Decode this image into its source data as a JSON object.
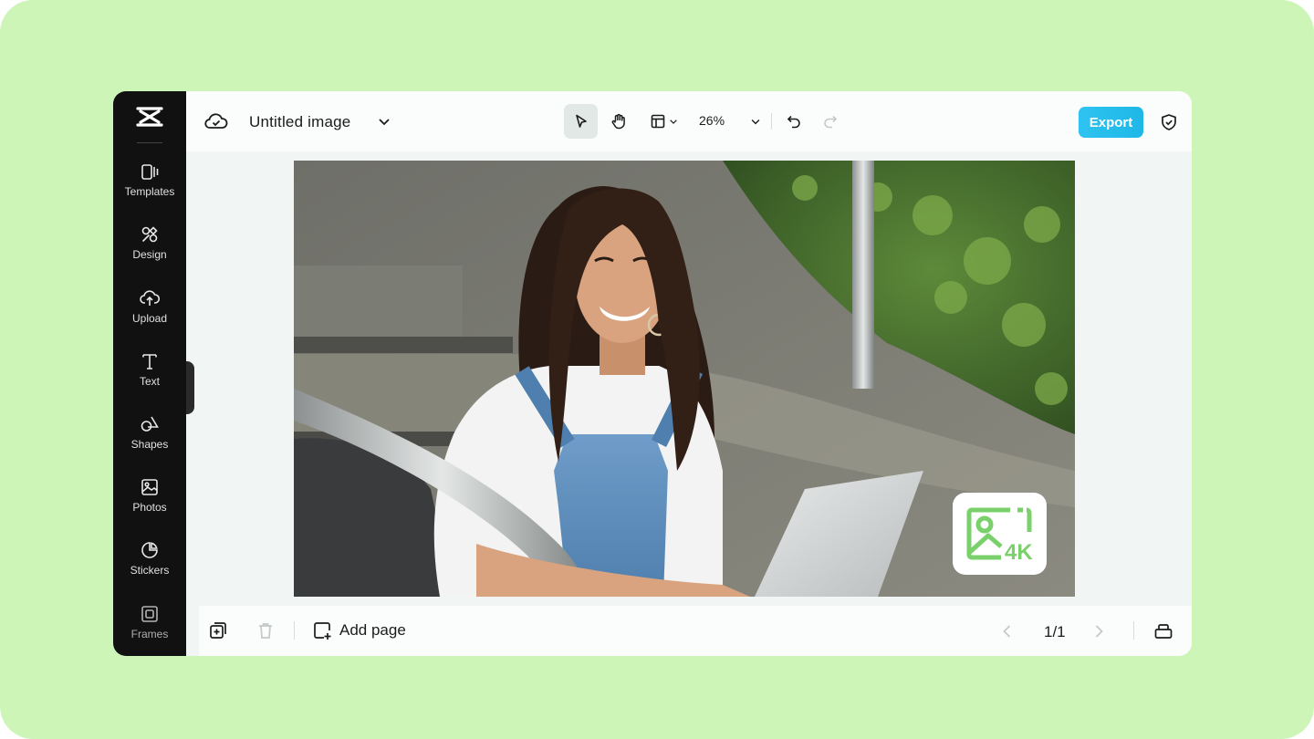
{
  "document": {
    "title": "Untitled image"
  },
  "sidebar": {
    "items": [
      {
        "label": "Templates",
        "icon": "templates-icon"
      },
      {
        "label": "Design",
        "icon": "design-icon"
      },
      {
        "label": "Upload",
        "icon": "upload-icon"
      },
      {
        "label": "Text",
        "icon": "text-icon"
      },
      {
        "label": "Shapes",
        "icon": "shapes-icon"
      },
      {
        "label": "Photos",
        "icon": "photos-icon"
      },
      {
        "label": "Stickers",
        "icon": "stickers-icon"
      },
      {
        "label": "Frames",
        "icon": "frames-icon"
      }
    ]
  },
  "toolbar": {
    "zoom": "26%",
    "export_label": "Export"
  },
  "footer": {
    "add_page_label": "Add page",
    "page_indicator": "1/1"
  },
  "badge": {
    "text": "4K"
  },
  "colors": {
    "accent": "#1eb8e6",
    "badge_green": "#7ad06a",
    "sidebar_bg": "#111111",
    "page_bg": "#cdf5b8"
  }
}
